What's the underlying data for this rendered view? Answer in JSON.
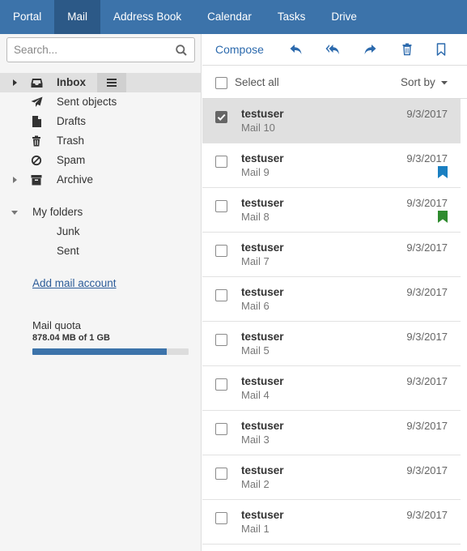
{
  "nav": {
    "items": [
      {
        "label": "Portal",
        "active": false
      },
      {
        "label": "Mail",
        "active": true
      },
      {
        "label": "Address Book",
        "active": false
      },
      {
        "label": "Calendar",
        "active": false
      },
      {
        "label": "Tasks",
        "active": false
      },
      {
        "label": "Drive",
        "active": false
      }
    ]
  },
  "sidebar": {
    "search_placeholder": "Search...",
    "folders": [
      {
        "label": "Inbox",
        "icon": "inbox-icon",
        "selected": true
      },
      {
        "label": "Sent objects",
        "icon": "paper-plane-icon"
      },
      {
        "label": "Drafts",
        "icon": "document-icon"
      },
      {
        "label": "Trash",
        "icon": "trash-icon"
      },
      {
        "label": "Spam",
        "icon": "ban-icon"
      },
      {
        "label": "Archive",
        "icon": "archive-icon"
      }
    ],
    "my_folders": {
      "label": "My folders",
      "items": [
        "Junk",
        "Sent"
      ]
    },
    "add_account_label": "Add mail account",
    "quota": {
      "label": "Mail quota",
      "value_text": "878.04 MB of 1 GB",
      "fraction": 0.858
    }
  },
  "toolbar": {
    "compose_label": "Compose",
    "icons": [
      "reply-icon",
      "reply-all-icon",
      "forward-icon",
      "delete-icon",
      "bookmark-icon"
    ]
  },
  "list": {
    "select_all_label": "Select all",
    "sort_label": "Sort by",
    "mails": [
      {
        "from": "testuser",
        "subject": "Mail 10",
        "date": "9/3/2017",
        "checked": true,
        "flag": null
      },
      {
        "from": "testuser",
        "subject": "Mail 9",
        "date": "9/3/2017",
        "checked": false,
        "flag": "blue"
      },
      {
        "from": "testuser",
        "subject": "Mail 8",
        "date": "9/3/2017",
        "checked": false,
        "flag": "green"
      },
      {
        "from": "testuser",
        "subject": "Mail 7",
        "date": "9/3/2017",
        "checked": false,
        "flag": null
      },
      {
        "from": "testuser",
        "subject": "Mail 6",
        "date": "9/3/2017",
        "checked": false,
        "flag": null
      },
      {
        "from": "testuser",
        "subject": "Mail 5",
        "date": "9/3/2017",
        "checked": false,
        "flag": null
      },
      {
        "from": "testuser",
        "subject": "Mail 4",
        "date": "9/3/2017",
        "checked": false,
        "flag": null
      },
      {
        "from": "testuser",
        "subject": "Mail 3",
        "date": "9/3/2017",
        "checked": false,
        "flag": null
      },
      {
        "from": "testuser",
        "subject": "Mail 2",
        "date": "9/3/2017",
        "checked": false,
        "flag": null
      },
      {
        "from": "testuser",
        "subject": "Mail 1",
        "date": "9/3/2017",
        "checked": false,
        "flag": null
      }
    ]
  },
  "colors": {
    "nav_bg": "#3c73aa",
    "nav_active": "#2c5987",
    "flag_blue": "#1a7fc1",
    "flag_green": "#2e8b2e",
    "accent": "#2c6aad"
  }
}
